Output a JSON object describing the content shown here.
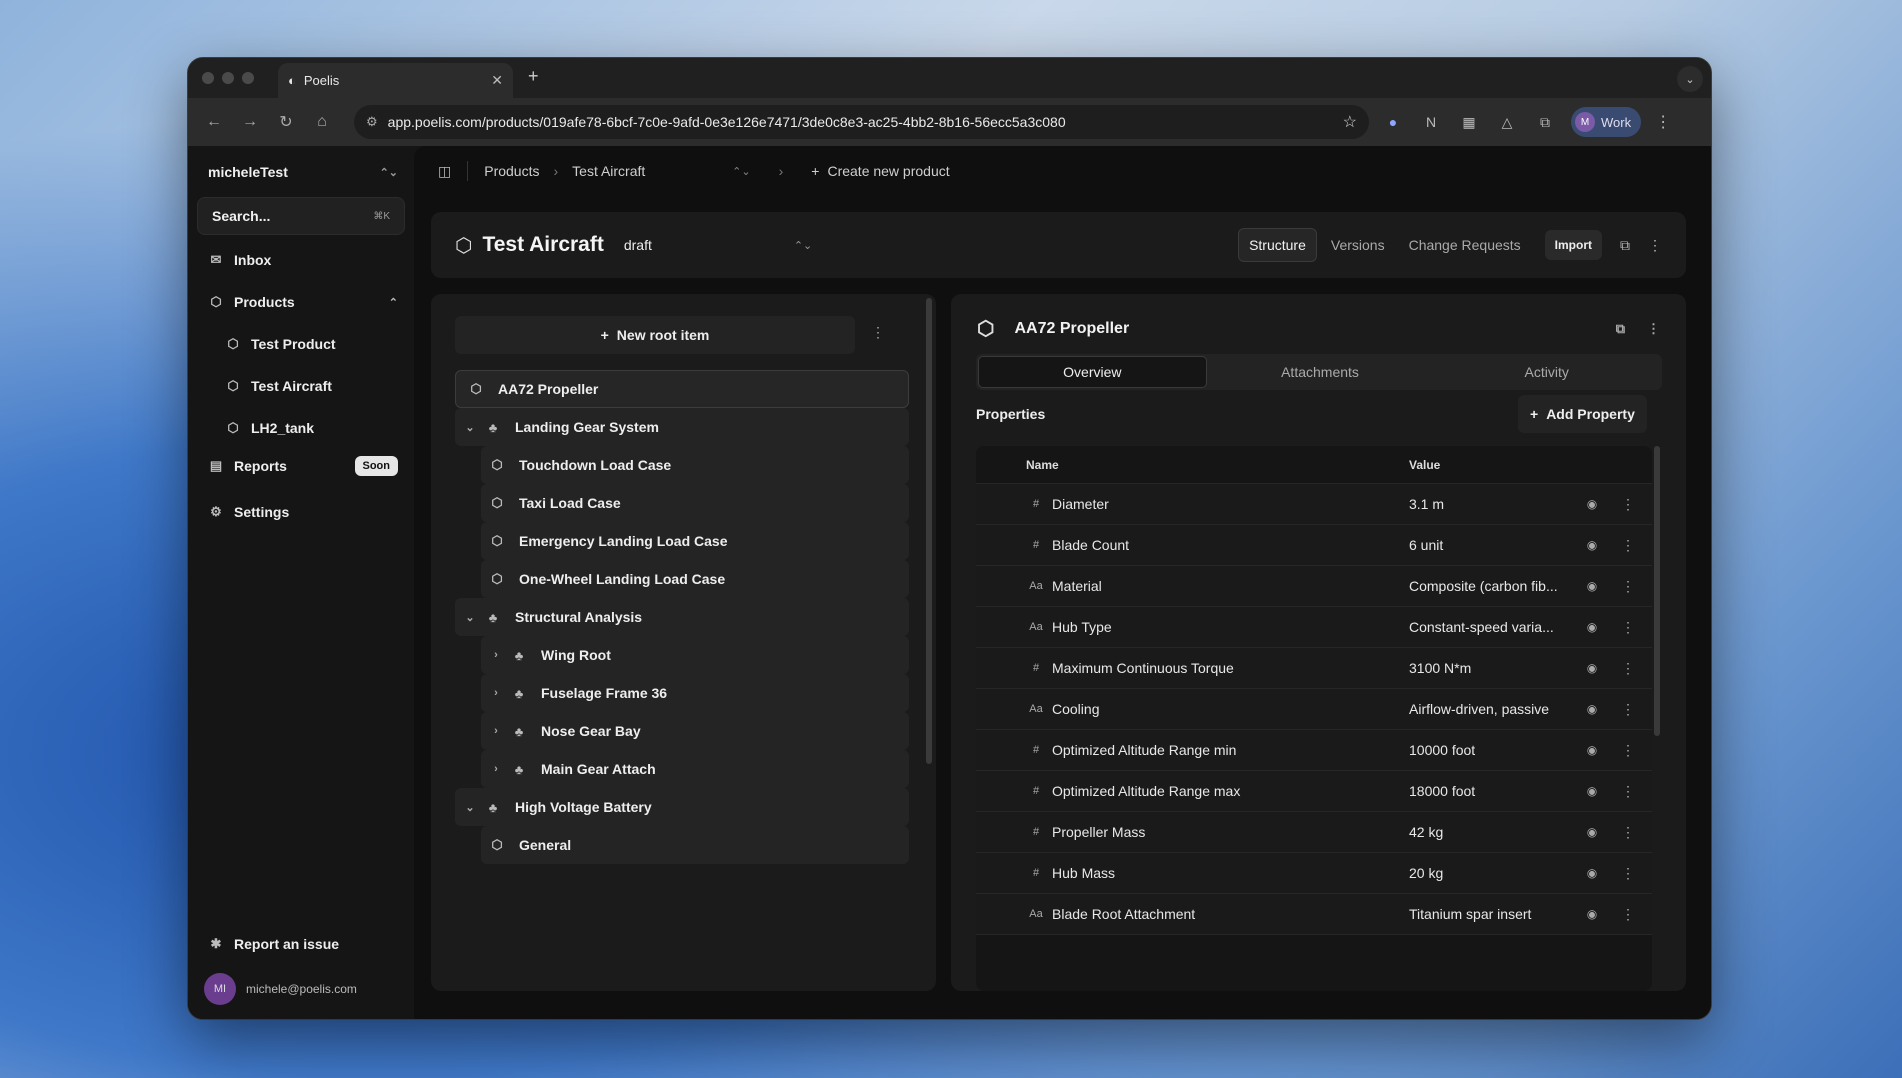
{
  "browser": {
    "tab_title": "Poelis",
    "url": "app.poelis.com/products/019afe78-6bcf-7c0e-9afd-0e3e126e7471/3de0c8e3-ac25-4bb2-8b16-56ecc5a3c080",
    "profile_label": "Work",
    "profile_initial": "M"
  },
  "sidebar": {
    "workspace": "micheleTest",
    "search_placeholder": "Search...",
    "search_shortcut": "⌘K",
    "items": [
      {
        "label": "Inbox"
      },
      {
        "label": "Products"
      },
      {
        "label": "Test Product"
      },
      {
        "label": "Test Aircraft"
      },
      {
        "label": "LH2_tank"
      },
      {
        "label": "Reports",
        "badge": "Soon"
      },
      {
        "label": "Settings"
      }
    ],
    "report_issue": "Report an issue",
    "user_initials": "MI",
    "user_email": "michele@poelis.com"
  },
  "breadcrumb": {
    "products": "Products",
    "current": "Test Aircraft",
    "create": "Create new product"
  },
  "header": {
    "title": "Test Aircraft",
    "status": "draft",
    "tabs": [
      "Structure",
      "Versions",
      "Change Requests"
    ],
    "import": "Import"
  },
  "tree": {
    "new_root": "New root item",
    "rows": [
      {
        "label": "AA72 Propeller"
      },
      {
        "label": "Landing Gear System"
      },
      {
        "label": "Touchdown Load Case"
      },
      {
        "label": "Taxi Load Case"
      },
      {
        "label": "Emergency Landing Load Case"
      },
      {
        "label": "One-Wheel Landing Load Case"
      },
      {
        "label": "Structural Analysis"
      },
      {
        "label": "Wing Root"
      },
      {
        "label": "Fuselage Frame 36"
      },
      {
        "label": "Nose Gear Bay"
      },
      {
        "label": "Main Gear Attach"
      },
      {
        "label": "High Voltage Battery"
      },
      {
        "label": "General"
      }
    ]
  },
  "detail": {
    "title": "AA72 Propeller",
    "tabs": [
      "Overview",
      "Attachments",
      "Activity"
    ],
    "properties_heading": "Properties",
    "add_property": "Add Property",
    "columns": {
      "name": "Name",
      "value": "Value"
    },
    "rows": [
      {
        "type": "#",
        "name": "Diameter",
        "value": "3.1 m"
      },
      {
        "type": "#",
        "name": "Blade Count",
        "value": "6 unit"
      },
      {
        "type": "Aa",
        "name": "Material",
        "value": "Composite (carbon fib..."
      },
      {
        "type": "Aa",
        "name": "Hub Type",
        "value": "Constant-speed varia..."
      },
      {
        "type": "#",
        "name": "Maximum Continuous Torque",
        "value": "3100 N*m"
      },
      {
        "type": "Aa",
        "name": "Cooling",
        "value": "Airflow-driven, passive"
      },
      {
        "type": "#",
        "name": "Optimized Altitude Range min",
        "value": "10000 foot"
      },
      {
        "type": "#",
        "name": "Optimized Altitude Range max",
        "value": "18000 foot"
      },
      {
        "type": "#",
        "name": "Propeller Mass",
        "value": "42 kg"
      },
      {
        "type": "#",
        "name": "Hub Mass",
        "value": "20 kg"
      },
      {
        "type": "Aa",
        "name": "Blade Root Attachment",
        "value": "Titanium spar insert"
      }
    ]
  },
  "icons": {
    "close": "close-icon",
    "plus": "plus-icon",
    "cube": "cube-icon",
    "group": "group-icon",
    "eye": "eye-icon",
    "kebab": "kebab-icon"
  }
}
